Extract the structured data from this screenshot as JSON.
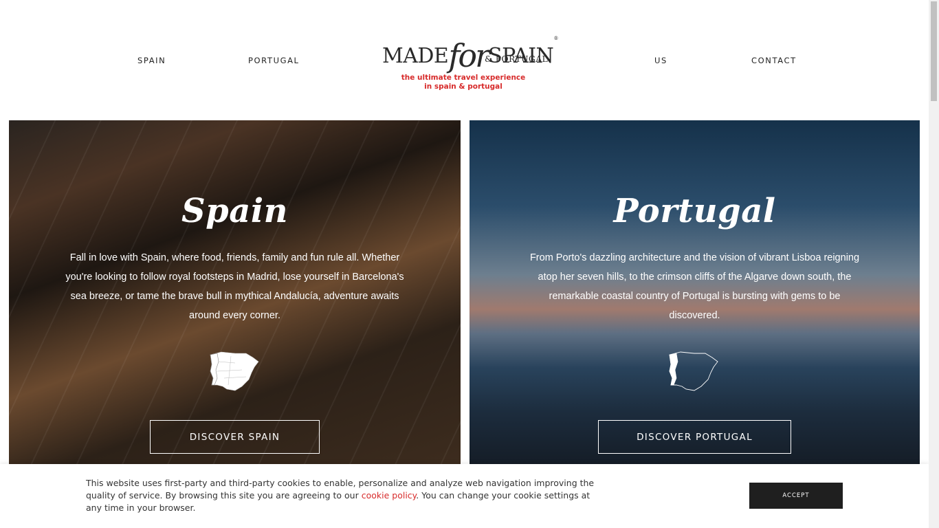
{
  "header": {
    "nav_left": [
      {
        "label": "SPAIN"
      },
      {
        "label": "PORTUGAL"
      }
    ],
    "nav_right": [
      {
        "label": "US"
      },
      {
        "label": "CONTACT"
      }
    ],
    "logo": {
      "made": "MADE",
      "for": "for",
      "spain": "SPAIN",
      "registered": "®",
      "sub": "& PORTUGAL",
      "tagline_line1": "the ultimate travel experience",
      "tagline_line2": "in spain & portugal"
    }
  },
  "panels": {
    "spain": {
      "title": "Spain",
      "text": "Fall in love with Spain, where food, friends, family and fun rule all. Whether you're looking to follow royal footsteps in Madrid, lose yourself in Barcelona's sea breeze, or tame the brave bull in mythical Andalucía, adventure awaits around every corner.",
      "button": "DISCOVER SPAIN",
      "map_icon": "iberia-map-spain-highlighted-icon"
    },
    "portugal": {
      "title": "Portugal",
      "text": "From Porto's dazzling architecture and the vision of vibrant Lisboa reigning atop her seven hills, to the crimson cliffs of the Algarve down south, the remarkable coastal country of Portugal is bursting with gems to be discovered.",
      "button": "DISCOVER PORTUGAL",
      "map_icon": "iberia-map-portugal-highlighted-icon"
    }
  },
  "cookie": {
    "text_before": "This website uses first-party and third-party cookies to enable, personalize and analyze web navigation improving the quality of service. By browsing this site you are agreeing to our ",
    "link": "cookie policy",
    "text_after": ". You can change your cookie settings at any time in your browser.",
    "accept": "ACCEPT"
  },
  "colors": {
    "accent_red": "#d72b2b",
    "button_dark": "#1f1f1f"
  }
}
